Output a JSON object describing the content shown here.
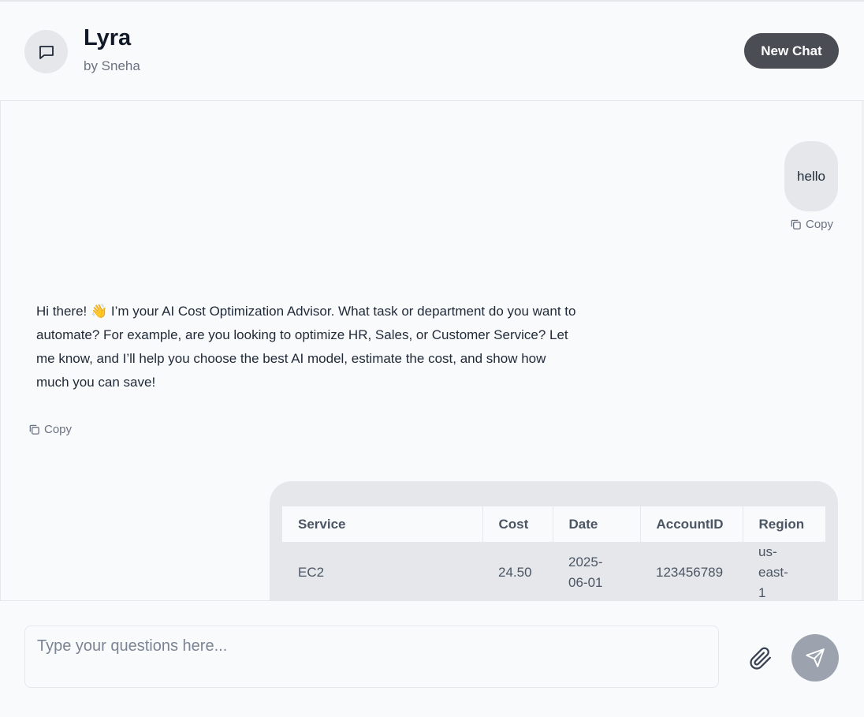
{
  "header": {
    "title": "Lyra",
    "subtitle": "by Sneha",
    "new_chat_label": "New Chat"
  },
  "messages": {
    "user_message": "hello",
    "copy_label": "Copy",
    "bot_message": "Hi there! 👋 I’m your AI Cost Optimization Advisor. What task or department do you want to automate? For example, are you looking to optimize HR, Sales, or Customer Service? Let me know, and I’ll help you choose the best AI model, estimate the cost, and show how much you can save!",
    "table": {
      "headers": [
        "Service",
        "Cost",
        "Date",
        "AccountID",
        "Region"
      ],
      "rows": [
        [
          "EC2",
          "24.50",
          "2025-06-01",
          "123456789",
          "us-east-1"
        ]
      ]
    }
  },
  "composer": {
    "placeholder": "Type your questions here..."
  },
  "icons": {
    "avatar": "chat-bubble-icon",
    "copy": "copy-icon",
    "attach": "paperclip-icon",
    "send": "send-icon"
  }
}
